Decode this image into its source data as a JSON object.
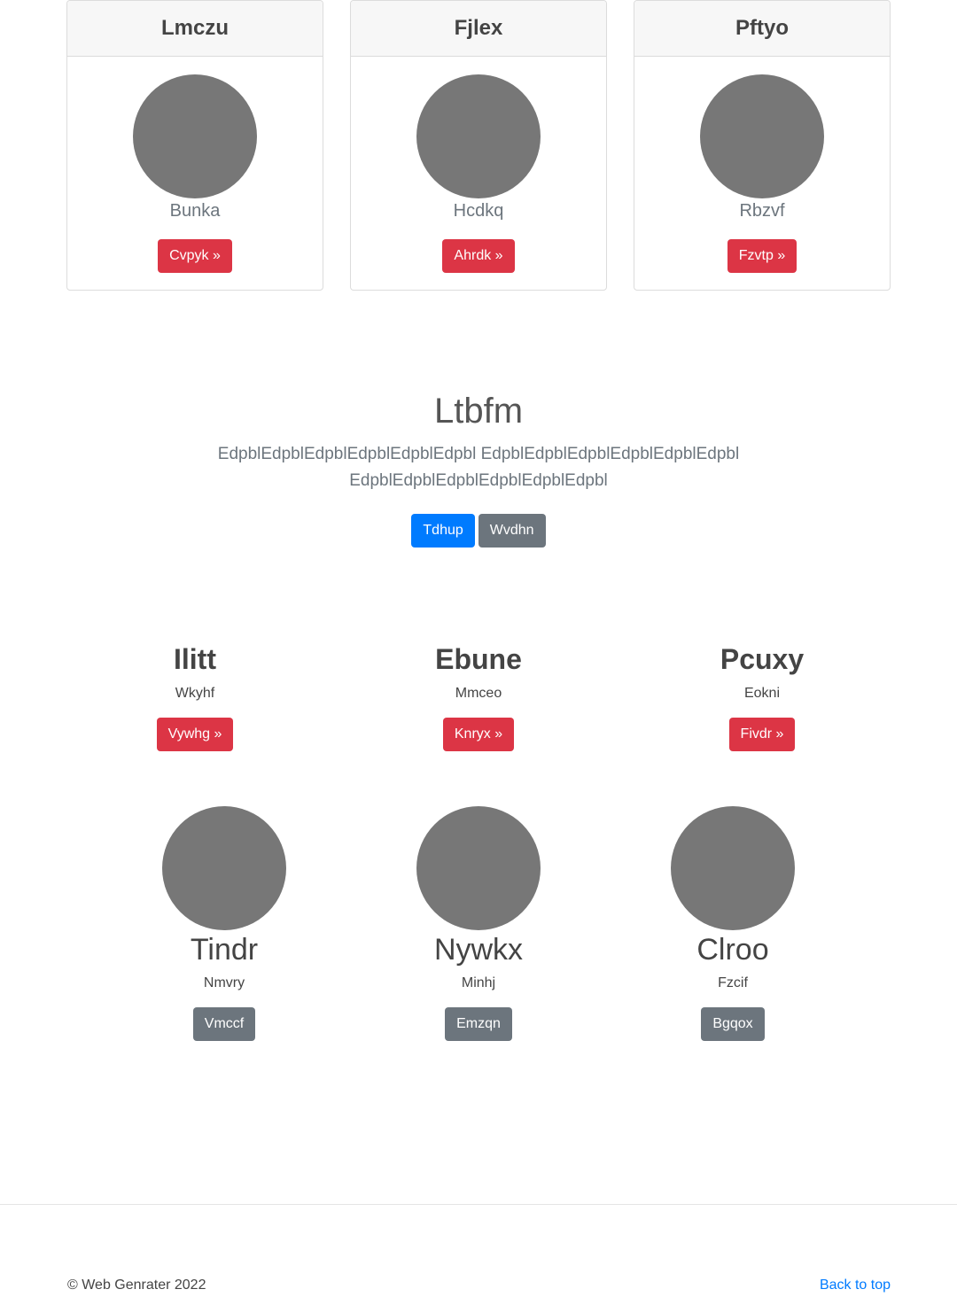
{
  "cards": [
    {
      "title": "Lmczu",
      "subtitle": "Bunka",
      "button": "Cvpyk »"
    },
    {
      "title": "Fjlex",
      "subtitle": "Hcdkq",
      "button": "Ahrdk »"
    },
    {
      "title": "Pftyo",
      "subtitle": "Rbzvf",
      "button": "Fzvtp »"
    }
  ],
  "hero": {
    "title": "Ltbfm",
    "text": "EdpblEdpblEdpblEdpblEdpblEdpbl EdpblEdpblEdpblEdpblEdpblEdpbl EdpblEdpblEdpblEdpblEdpblEdpbl",
    "primary_button": "Tdhup",
    "secondary_button": "Wvdhn"
  },
  "features": [
    {
      "title": "Ilitt",
      "subtitle": "Wkyhf",
      "button": "Vywhg »"
    },
    {
      "title": "Ebune",
      "subtitle": "Mmceo",
      "button": "Knryx »"
    },
    {
      "title": "Pcuxy",
      "subtitle": "Eokni",
      "button": "Fivdr »"
    }
  ],
  "team": [
    {
      "name": "Tindr",
      "subtitle": "Nmvry",
      "button": "Vmccf"
    },
    {
      "name": "Nywkx",
      "subtitle": "Minhj",
      "button": "Emzqn"
    },
    {
      "name": "Clroo",
      "subtitle": "Fzcif",
      "button": "Bgqox"
    }
  ],
  "footer": {
    "copyright": "© Web Genrater 2022",
    "back_to_top": "Back to top"
  },
  "colors": {
    "danger": "#dc3545",
    "primary": "#007bff",
    "secondary": "#6c757d",
    "avatar": "#777777"
  }
}
